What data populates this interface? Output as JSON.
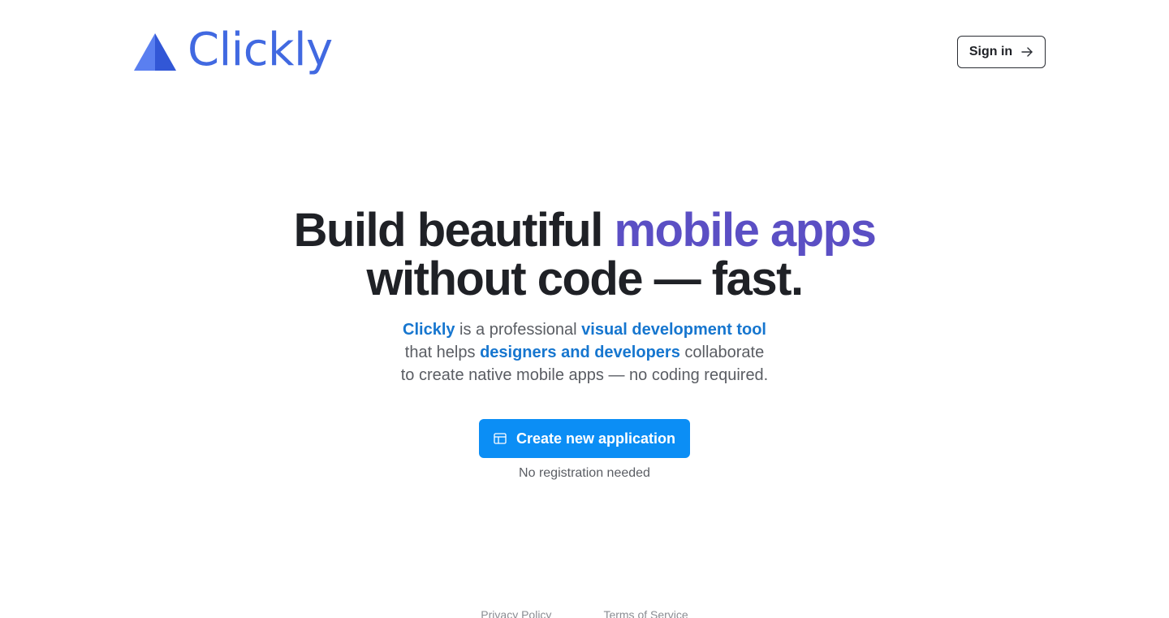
{
  "brand": {
    "name": "Clickly",
    "logo_icon": "paper-plane-triangle-icon",
    "color": "#4169e1"
  },
  "header": {
    "signin_label": "Sign in",
    "signin_icon": "arrow-right-icon"
  },
  "hero": {
    "title_part1": "Build beautiful ",
    "title_accent": "mobile apps",
    "title_line2": "without code — fast.",
    "accent_color": "#5b4fc4",
    "subtitle": {
      "line1_hl1": "Clickly",
      "line1_text": " is a professional ",
      "line1_hl2": "visual development tool",
      "line2_text1": "that helps ",
      "line2_hl": "designers and developers",
      "line2_text2": " collaborate",
      "line3": "to create native mobile apps — no coding required."
    },
    "cta_label": "Create new application",
    "cta_icon": "layout-icon",
    "cta_color": "#0b8ef5",
    "cta_note": "No registration needed"
  },
  "footer": {
    "links": [
      "Privacy Policy",
      "Terms of Service"
    ]
  }
}
